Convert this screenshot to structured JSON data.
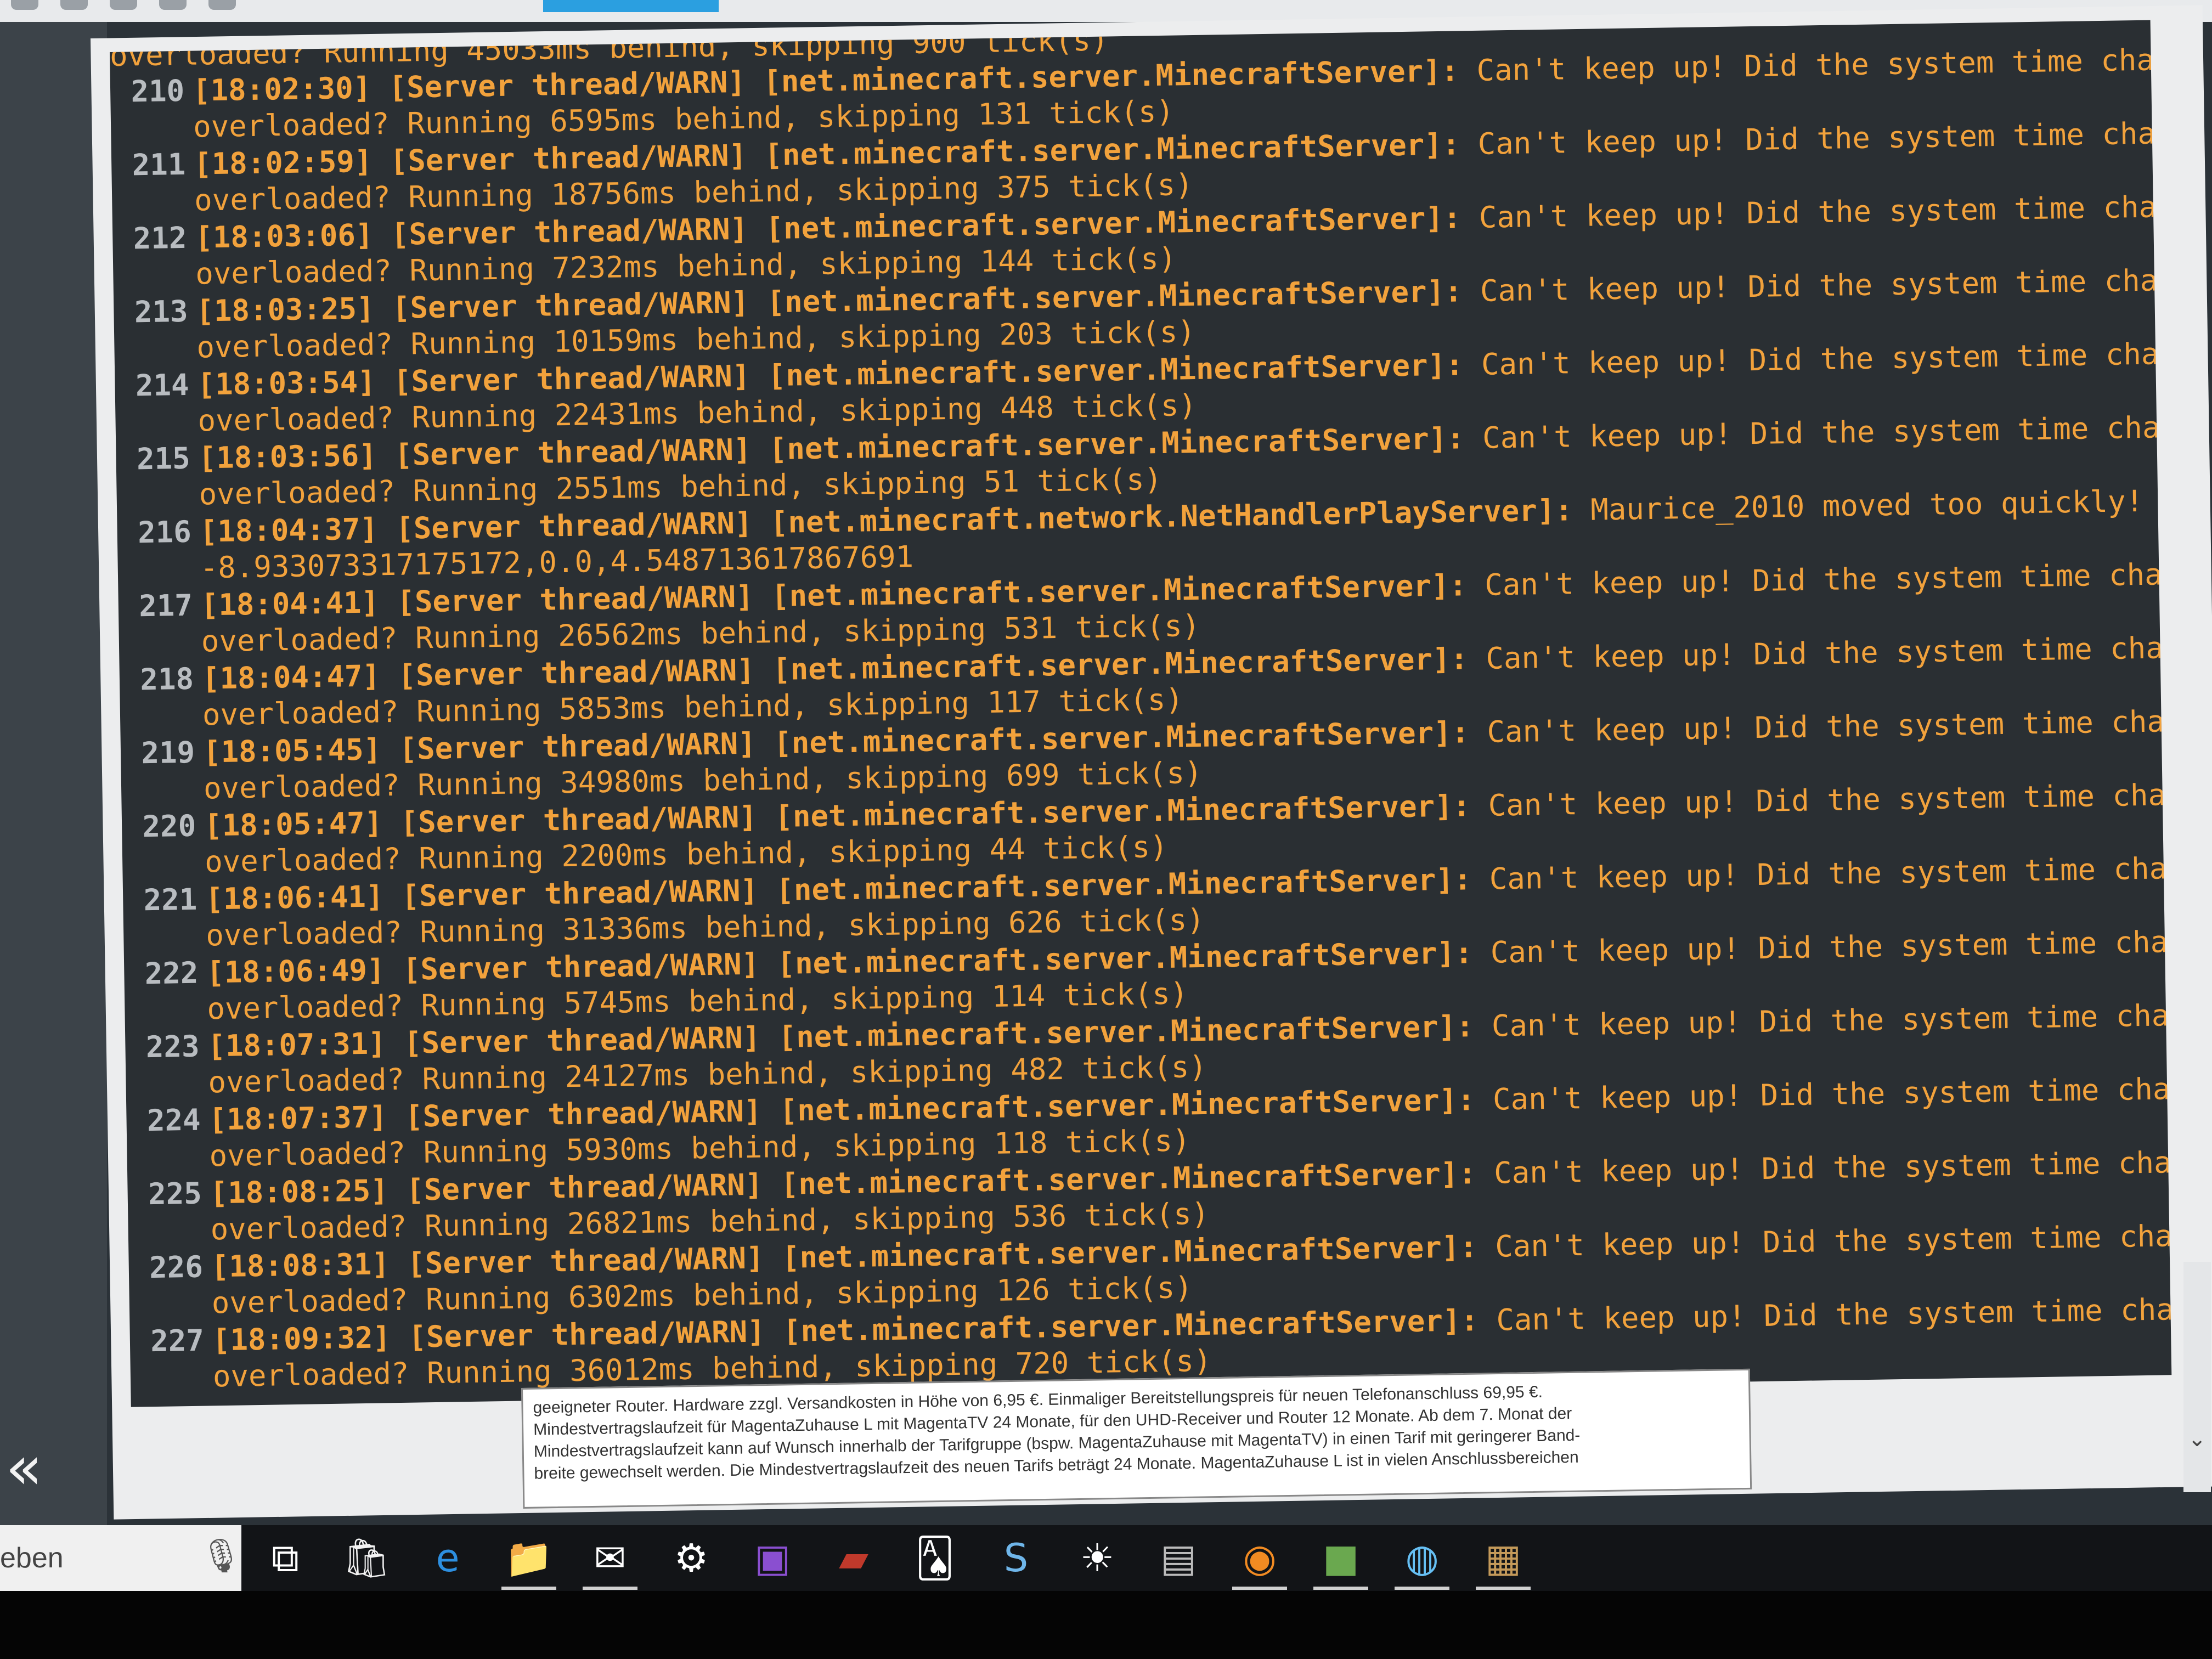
{
  "top_partial_line": "overloaded? Running 45033ms behind, skipping 900 tick(s)",
  "log_lines": [
    {
      "num": "210",
      "ts": "[18:02:30]",
      "thread": "[Server thread/WARN]",
      "source": "[net.minecraft.server.MinecraftServer]:",
      "msg": "Can't keep up! Did the system time change, or is the server",
      "cont": "overloaded? Running 6595ms behind, skipping 131 tick(s)"
    },
    {
      "num": "211",
      "ts": "[18:02:59]",
      "thread": "[Server thread/WARN]",
      "source": "[net.minecraft.server.MinecraftServer]:",
      "msg": "Can't keep up! Did the system time change, or is the server",
      "cont": "overloaded? Running 18756ms behind, skipping 375 tick(s)"
    },
    {
      "num": "212",
      "ts": "[18:03:06]",
      "thread": "[Server thread/WARN]",
      "source": "[net.minecraft.server.MinecraftServer]:",
      "msg": "Can't keep up! Did the system time change, or is the server",
      "cont": "overloaded? Running 7232ms behind, skipping 144 tick(s)"
    },
    {
      "num": "213",
      "ts": "[18:03:25]",
      "thread": "[Server thread/WARN]",
      "source": "[net.minecraft.server.MinecraftServer]:",
      "msg": "Can't keep up! Did the system time change, or is the server",
      "cont": "overloaded? Running 10159ms behind, skipping 203 tick(s)"
    },
    {
      "num": "214",
      "ts": "[18:03:54]",
      "thread": "[Server thread/WARN]",
      "source": "[net.minecraft.server.MinecraftServer]:",
      "msg": "Can't keep up! Did the system time change, or is the server",
      "cont": "overloaded? Running 22431ms behind, skipping 448 tick(s)"
    },
    {
      "num": "215",
      "ts": "[18:03:56]",
      "thread": "[Server thread/WARN]",
      "source": "[net.minecraft.server.MinecraftServer]:",
      "msg": "Can't keep up! Did the system time change, or is the server",
      "cont": "overloaded? Running 2551ms behind, skipping 51 tick(s)"
    },
    {
      "num": "216",
      "ts": "[18:04:37]",
      "thread": "[Server thread/WARN]",
      "source": "[net.minecraft.network.NetHandlerPlayServer]:",
      "msg": "Maurice_2010 moved too quickly!",
      "cont": "-8.933073317175172,0.0,4.548713617867691"
    },
    {
      "num": "217",
      "ts": "[18:04:41]",
      "thread": "[Server thread/WARN]",
      "source": "[net.minecraft.server.MinecraftServer]:",
      "msg": "Can't keep up! Did the system time change, or is the server",
      "cont": "overloaded? Running 26562ms behind, skipping 531 tick(s)"
    },
    {
      "num": "218",
      "ts": "[18:04:47]",
      "thread": "[Server thread/WARN]",
      "source": "[net.minecraft.server.MinecraftServer]:",
      "msg": "Can't keep up! Did the system time change, or is the server",
      "cont": "overloaded? Running 5853ms behind, skipping 117 tick(s)"
    },
    {
      "num": "219",
      "ts": "[18:05:45]",
      "thread": "[Server thread/WARN]",
      "source": "[net.minecraft.server.MinecraftServer]:",
      "msg": "Can't keep up! Did the system time change, or is the server",
      "cont": "overloaded? Running 34980ms behind, skipping 699 tick(s)"
    },
    {
      "num": "220",
      "ts": "[18:05:47]",
      "thread": "[Server thread/WARN]",
      "source": "[net.minecraft.server.MinecraftServer]:",
      "msg": "Can't keep up! Did the system time change, or is the server",
      "cont": "overloaded? Running 2200ms behind, skipping 44 tick(s)"
    },
    {
      "num": "221",
      "ts": "[18:06:41]",
      "thread": "[Server thread/WARN]",
      "source": "[net.minecraft.server.MinecraftServer]:",
      "msg": "Can't keep up! Did the system time change, or is the server",
      "cont": "overloaded? Running 31336ms behind, skipping 626 tick(s)"
    },
    {
      "num": "222",
      "ts": "[18:06:49]",
      "thread": "[Server thread/WARN]",
      "source": "[net.minecraft.server.MinecraftServer]:",
      "msg": "Can't keep up! Did the system time change, or is the server",
      "cont": "overloaded? Running 5745ms behind, skipping 114 tick(s)"
    },
    {
      "num": "223",
      "ts": "[18:07:31]",
      "thread": "[Server thread/WARN]",
      "source": "[net.minecraft.server.MinecraftServer]:",
      "msg": "Can't keep up! Did the system time change, or is the server",
      "cont": "overloaded? Running 24127ms behind, skipping 482 tick(s)"
    },
    {
      "num": "224",
      "ts": "[18:07:37]",
      "thread": "[Server thread/WARN]",
      "source": "[net.minecraft.server.MinecraftServer]:",
      "msg": "Can't keep up! Did the system time change, or is the server",
      "cont": "overloaded? Running 5930ms behind, skipping 118 tick(s)"
    },
    {
      "num": "225",
      "ts": "[18:08:25]",
      "thread": "[Server thread/WARN]",
      "source": "[net.minecraft.server.MinecraftServer]:",
      "msg": "Can't keep up! Did the system time change, or is the server",
      "cont": "overloaded? Running 26821ms behind, skipping 536 tick(s)"
    },
    {
      "num": "226",
      "ts": "[18:08:31]",
      "thread": "[Server thread/WARN]",
      "source": "[net.minecraft.server.MinecraftServer]:",
      "msg": "Can't keep up! Did the system time change, or is the server",
      "cont": "overloaded? Running 6302ms behind, skipping 126 tick(s)"
    },
    {
      "num": "227",
      "ts": "[18:09:32]",
      "thread": "[Server thread/WARN]",
      "source": "[net.minecraft.server.MinecraftServer]:",
      "msg": "Can't keep up! Did the system time change, or is the server",
      "cont": "overloaded? Running 36012ms behind, skipping 720 tick(s)"
    }
  ],
  "ad_text": [
    "geeigneter Router. Hardware zzgl. Versandkosten in Höhe von 6,95 €. Einmaliger Bereitstellungspreis für neuen Telefonanschluss 69,95 €.",
    "Mindestvertragslaufzeit für MagentaZuhause L mit MagentaTV 24 Monate, für den UHD-Receiver und Router 12 Monate. Ab dem 7. Monat der",
    "Mindestvertragslaufzeit kann auf Wunsch innerhalb der Tarifgruppe (bspw. MagentaZuhause mit MagentaTV) in einen Tarif mit geringerer Band-",
    "breite gewechselt werden. Die Mindestvertragslaufzeit des neuen Tarifs beträgt 24 Monate. MagentaZuhause L ist in vielen Anschlussbereichen"
  ],
  "sidebar": {
    "collapse_glyph": "«"
  },
  "taskbar": {
    "search_text": "eben",
    "icons": [
      {
        "name": "task-view-icon",
        "glyph": "⧉",
        "color": "#ffffff"
      },
      {
        "name": "store-icon",
        "glyph": "🛍",
        "color": "#f3f3f3"
      },
      {
        "name": "edge-icon",
        "glyph": "e",
        "color": "#2d8fe0"
      },
      {
        "name": "file-explorer-icon",
        "glyph": "📁",
        "color": "#f2c14e"
      },
      {
        "name": "mail-icon",
        "glyph": "✉",
        "color": "#ffffff"
      },
      {
        "name": "settings-icon",
        "glyph": "⚙",
        "color": "#ffffff"
      },
      {
        "name": "photos-icon",
        "glyph": "▣",
        "color": "#8a4fd0"
      },
      {
        "name": "app-red-icon",
        "glyph": "▰",
        "color": "#c0392b"
      },
      {
        "name": "solitaire-icon",
        "glyph": "🂡",
        "color": "#ffffff"
      },
      {
        "name": "skype-icon",
        "glyph": "S",
        "color": "#6fb6ea"
      },
      {
        "name": "brightness-icon",
        "glyph": "☀",
        "color": "#ffffff"
      },
      {
        "name": "app-gray-icon",
        "glyph": "▤",
        "color": "#bbbbbb"
      },
      {
        "name": "firefox-icon",
        "glyph": "◉",
        "color": "#f28b22"
      },
      {
        "name": "minecraft-icon",
        "glyph": "■",
        "color": "#6aa84f"
      },
      {
        "name": "steam-icon",
        "glyph": "◍",
        "color": "#66c0f4"
      },
      {
        "name": "chest-icon",
        "glyph": "▦",
        "color": "#c49a5a"
      }
    ]
  }
}
